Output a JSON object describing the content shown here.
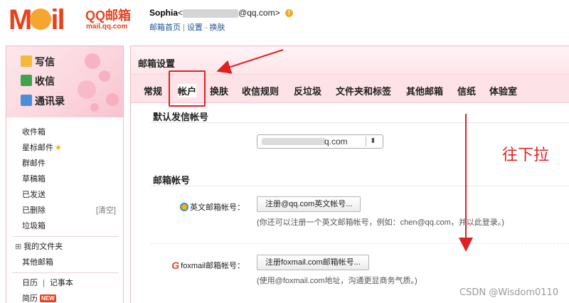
{
  "header": {
    "logo_main": "MOil",
    "logo_brand": "QQ邮箱",
    "logo_domain": "mail.qq.com",
    "user_name": "Sophia",
    "user_email_prefix": "<",
    "user_email_suffix": "@qq.com>",
    "warning_glyph": "!",
    "links": [
      "邮箱首页",
      "设置",
      "换肤"
    ]
  },
  "sidebar": {
    "actions": [
      {
        "label": "写信",
        "icon": "pencil-icon"
      },
      {
        "label": "收信",
        "icon": "inbox-download-icon"
      },
      {
        "label": "通讯录",
        "icon": "contacts-icon"
      }
    ],
    "folders": [
      {
        "label": "收件箱"
      },
      {
        "label": "星标邮件",
        "star": "★"
      },
      {
        "label": "群邮件"
      },
      {
        "label": "草稿箱"
      },
      {
        "label": "已发送"
      },
      {
        "label": "已删除",
        "extra": "[清空]"
      },
      {
        "label": "垃圾箱"
      }
    ],
    "my_folders": "我的文件夹",
    "my_folders_toggle": "⊞",
    "other_mailbox": "其他邮箱",
    "calendar": "日历",
    "notes": "记事本",
    "separator": "|",
    "resume": "简历",
    "new_badge": "NEW"
  },
  "main": {
    "title": "邮箱设置",
    "tabs": [
      "常规",
      "帐户",
      "换肤",
      "收信规则",
      "反垃圾",
      "文件夹和标签",
      "其他邮箱",
      "信纸",
      "体验室"
    ],
    "active_tab_index": 1,
    "default_sender": {
      "title": "默认发信帐号",
      "select_value": "q.com",
      "select_caret": "⬍"
    },
    "mail_account": {
      "title": "邮箱帐号",
      "english": {
        "label": "英文邮箱帐号：",
        "button": "注册@qq.com英文帐号...",
        "hint": "(你还可以注册一个英文邮箱帐号，例如：chen@qq.com，并以此登录。)"
      },
      "foxmail": {
        "label": "foxmail邮箱帐号：",
        "icon_glyph": "G",
        "button": "注册foxmail.com邮箱帐号...",
        "hint": "(使用@foxmail.com地址，沟通更显商务气质。)"
      }
    }
  },
  "annotation": {
    "text": "往下拉",
    "color": "#e02020"
  },
  "watermark": "CSDN @Wisdom0110",
  "colors": {
    "brand": "#e8421d",
    "tab_bar": "#fde3e8",
    "link": "#1d5494"
  }
}
